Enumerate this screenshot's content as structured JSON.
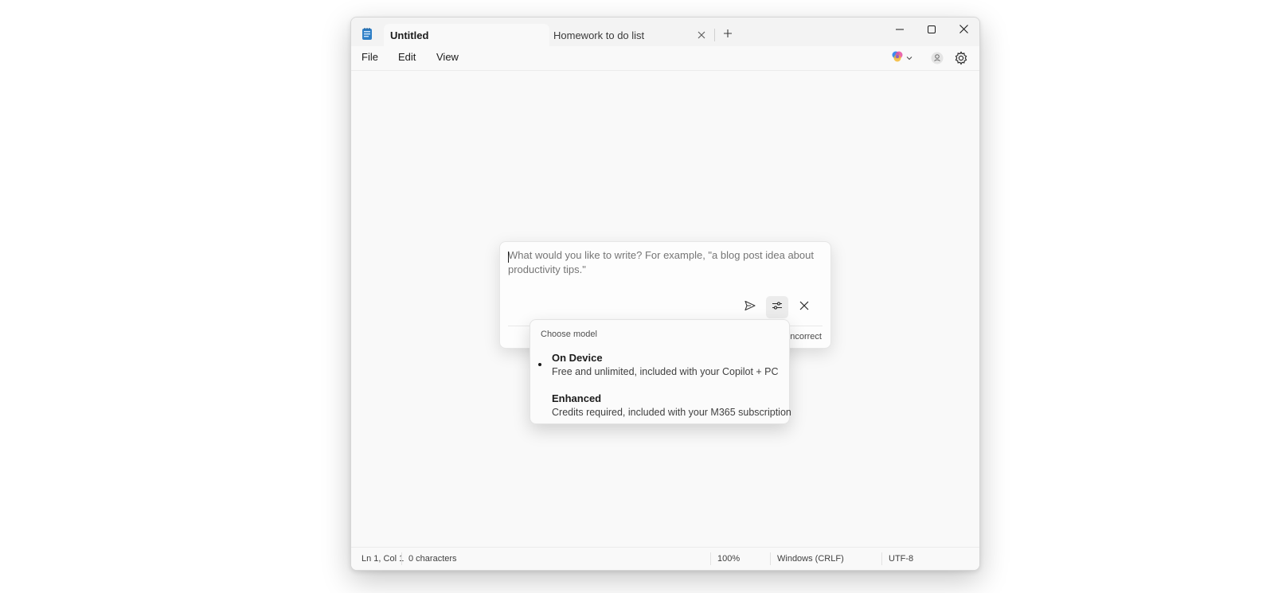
{
  "window": {
    "tabs": [
      {
        "label": "Untitled",
        "active": true
      },
      {
        "label": "Homework to do list",
        "active": false
      }
    ]
  },
  "menu": {
    "items": [
      "File",
      "Edit",
      "View"
    ]
  },
  "icons": {
    "app": "notepad-icon",
    "tab_close": "close-icon",
    "new_tab": "plus-icon",
    "minimize": "minimize-icon",
    "maximize": "maximize-icon",
    "close": "close-icon",
    "copilot": "copilot-icon",
    "account": "account-icon",
    "settings": "gear-icon",
    "send": "send-icon",
    "model_options": "sliders-icon",
    "dismiss": "close-icon"
  },
  "write_panel": {
    "placeholder": "What would you like to write? For example, \"a blog post idea about productivity tips.\"",
    "footnote": "ncorrect"
  },
  "model_menu": {
    "heading": "Choose model",
    "options": [
      {
        "name": "On Device",
        "description": "Free and unlimited, included with your Copilot + PC",
        "selected": true
      },
      {
        "name": "Enhanced",
        "description": "Credits required, included with your M365 subscription",
        "selected": false
      }
    ]
  },
  "status": {
    "position": "Ln 1, Col 1",
    "characters": "0 characters",
    "zoom": "100%",
    "line_endings": "Windows (CRLF)",
    "encoding": "UTF-8"
  },
  "colors": {
    "window_bg": "#f9f9f9",
    "titlebar_bg": "#f3f3f3",
    "accent": "#0067c0"
  }
}
